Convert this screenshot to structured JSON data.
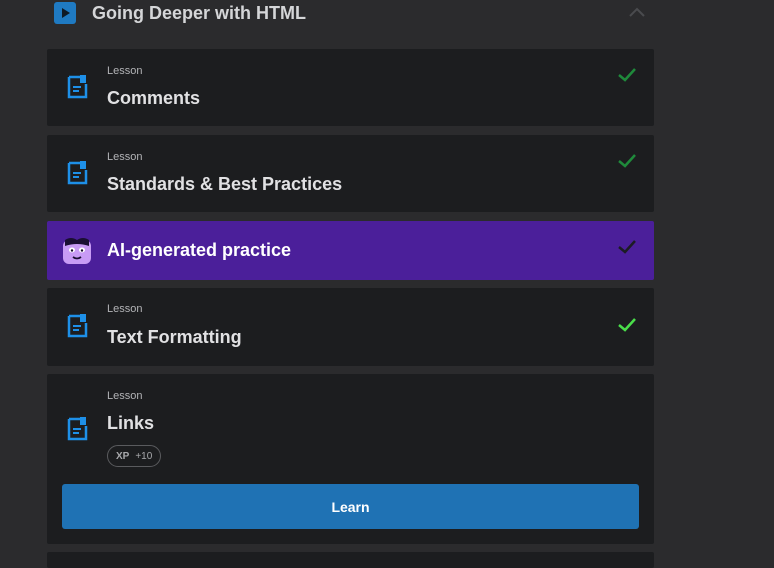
{
  "section": {
    "title": "Going Deeper with HTML",
    "icon": "play-icon",
    "collapse_icon": "chevron-up-icon"
  },
  "items": [
    {
      "type": "lesson",
      "kicker": "Lesson",
      "title": "Comments",
      "completed": true,
      "check_color": "#1f8a3b"
    },
    {
      "type": "lesson",
      "kicker": "Lesson",
      "title": "Standards & Best Practices",
      "completed": true,
      "check_color": "#1f8a3b"
    },
    {
      "type": "practice",
      "title": "AI-generated practice",
      "completed": true,
      "check_color": "#1c1c24"
    },
    {
      "type": "lesson",
      "kicker": "Lesson",
      "title": "Text Formatting",
      "completed": true,
      "check_color": "#4ade4a"
    },
    {
      "type": "lesson",
      "kicker": "Lesson",
      "title": "Links",
      "completed": false,
      "xp_label": "XP",
      "xp_value": "+10",
      "button_label": "Learn"
    }
  ],
  "colors": {
    "background": "#2b2b2d",
    "card": "#1c1d1f",
    "accent_blue": "#1f72b4",
    "lesson_icon": "#1e90e8",
    "practice_bg": "#4b1f9a"
  }
}
